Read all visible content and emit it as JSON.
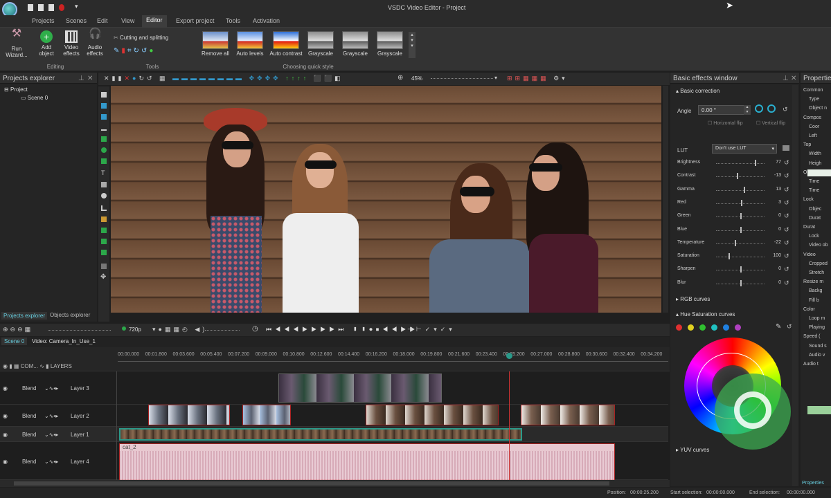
{
  "app": {
    "title": "VSDC Video Editor - Project"
  },
  "menu": [
    "Projects",
    "Scenes",
    "Edit",
    "View",
    "Editor",
    "Export project",
    "Tools",
    "Activation"
  ],
  "menu_active": "Editor",
  "ribbon": {
    "run_wizard": "Run Wizard...",
    "add_object": "Add object",
    "video_effects": "Video effects",
    "audio_effects": "Audio effects",
    "group_editing": "Editing",
    "cutting": "Cutting and splitting",
    "group_tools": "Tools",
    "quick": [
      "Remove all",
      "Auto levels",
      "Auto contrast",
      "Grayscale",
      "Grayscale",
      "Grayscale"
    ],
    "group_quick": "Choosing quick style"
  },
  "projects": {
    "title": "Projects explorer",
    "project": "Project",
    "scene": "Scene 0",
    "tab1": "Projects explorer",
    "tab2": "Objects explorer"
  },
  "preview": {
    "zoom": "45%"
  },
  "playback": {
    "quality": "720p"
  },
  "timeline": {
    "tab_scene": "Scene 0",
    "tab_clip": "Video: Camera_In_Use_1",
    "com_label": "COM...",
    "layers_label": "LAYERS",
    "times": [
      "00:00.000",
      "00:01.800",
      "00:03.600",
      "00:05.400",
      "00:07.200",
      "00:09.000",
      "00:10.800",
      "00:12.600",
      "00:14.400",
      "00:16.200",
      "00:18.000",
      "00:19.800",
      "00:21.600",
      "00:23.400",
      "00:25.200",
      "00:27.000",
      "00:28.800",
      "00:30.600",
      "00:32.400",
      "00:34.200"
    ],
    "tracks": [
      {
        "blend": "Blend",
        "name": "Layer 3"
      },
      {
        "blend": "Blend",
        "name": "Layer 2"
      },
      {
        "blend": "Blend",
        "name": "Layer 1"
      },
      {
        "blend": "Blend",
        "name": "Layer 4"
      }
    ],
    "audio_clip": "cat_2"
  },
  "effects": {
    "title": "Basic effects window",
    "basic": "Basic correction",
    "angle_label": "Angle",
    "angle_value": "0.00 °",
    "hflip": "Horizontal flip",
    "vflip": "Vertical flip",
    "lut_label": "LUT",
    "lut_value": "Don't use LUT",
    "sliders": [
      {
        "label": "Brightness",
        "value": "77",
        "pos": 0.8
      },
      {
        "label": "Contrast",
        "value": "-13",
        "pos": 0.43
      },
      {
        "label": "Gamma",
        "value": "13",
        "pos": 0.57
      },
      {
        "label": "Red",
        "value": "3",
        "pos": 0.52
      },
      {
        "label": "Green",
        "value": "0",
        "pos": 0.5
      },
      {
        "label": "Blue",
        "value": "0",
        "pos": 0.5
      },
      {
        "label": "Temperature",
        "value": "-22",
        "pos": 0.39
      },
      {
        "label": "Saturation",
        "value": "100",
        "pos": 0.25
      },
      {
        "label": "Sharpen",
        "value": "0",
        "pos": 0.5
      },
      {
        "label": "Blur",
        "value": "0",
        "pos": 0.5
      }
    ],
    "rgb_curves": "RGB curves",
    "hue_sat": "Hue Saturation curves",
    "yuv": "YUV curves",
    "dot_colors": [
      "#e03030",
      "#e0d020",
      "#30c030",
      "#20c0c0",
      "#2080e0",
      "#b040c0"
    ]
  },
  "properties": {
    "title": "Properties",
    "items": [
      "Common",
      "Type",
      "Object n",
      "Compos",
      "Coor",
      "Left",
      "Top",
      "Width",
      "Heigh",
      "Objec",
      "Time",
      "Time",
      "Lock",
      "Objec",
      "Durat",
      "Durat",
      "Lock",
      "Video ob",
      "Video",
      "Cropped",
      "Stretch",
      "Resize m",
      "Backg",
      "Fill b",
      "Color",
      "Loop m",
      "Playing",
      "Speed (",
      "Sound s",
      "Audio v",
      "Audio t"
    ],
    "tab": "Properties"
  },
  "status": {
    "position_label": "Position:",
    "position": "00:00:25.200",
    "start_label": "Start selection:",
    "start": "00:00:00.000",
    "end_label": "End selection:",
    "end": "00:00:00.000"
  }
}
